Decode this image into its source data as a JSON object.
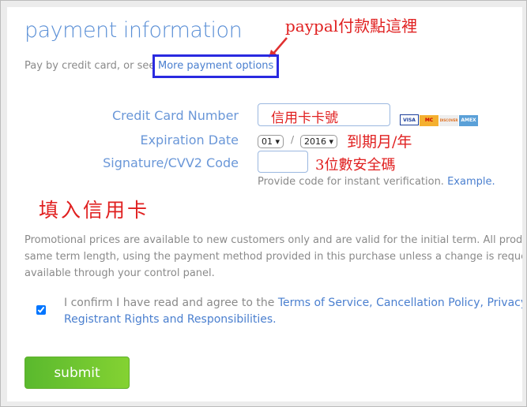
{
  "header": {
    "title": "payment information",
    "intro": "Pay by credit card, or see",
    "more_link": "More payment options"
  },
  "annotations": {
    "paypal": "paypal付款點這裡",
    "card_number": "信用卡卡號",
    "expiry": "到期月/年",
    "cvv": "3位數安全碼",
    "fill_in": "填入信用卡"
  },
  "form": {
    "card_number_label": "Credit Card Number",
    "expiration_label": "Expiration Date",
    "month": "01",
    "year": "2016",
    "separator": "/",
    "cvv_label": "Signature/CVV2 Code",
    "cvv_hint": "Provide code for instant verification.",
    "example_link": "Example.",
    "cards": [
      "VISA",
      "MC",
      "DISCOVER",
      "AMEX"
    ]
  },
  "terms": {
    "promo_lines": [
      "Promotional prices are available to new customers only and are valid for the initial term. All produc",
      "same term length, using the payment method provided in this purchase unless a change is reques",
      "available through your control panel."
    ],
    "confirm_text": "I confirm I have read and agree to the",
    "links": [
      "Terms of Service,",
      "Cancellation Policy,",
      "Privacy Stater",
      "Registrant Rights and Responsibilities."
    ],
    "checked": true
  },
  "submit_label": "submit",
  "colors": {
    "accent": "#4a7fcf",
    "annotation": "#e02020",
    "highlight_box": "#2a2ae0",
    "submit": "#6cc430"
  }
}
